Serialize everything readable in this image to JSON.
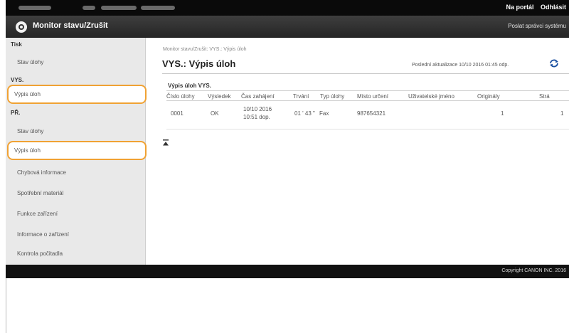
{
  "top_links": {
    "portal": "Na portál",
    "logout": "Odhlásit"
  },
  "header": {
    "title": "Monitor stavu/Zrušit",
    "mail_admin": "Poslat správci systému"
  },
  "sidebar": {
    "print_heading": "Tisk",
    "print_job_status": "Stav úlohy",
    "send_heading": "VYS.",
    "send_job_log": "Výpis úloh",
    "receive_heading": "PŘ.",
    "receive_job_status": "Stav úlohy",
    "receive_job_log": "Výpis úloh",
    "error_info": "Chybová informace",
    "consumables": "Spotřební materiál",
    "device_features": "Funkce zařízení",
    "device_info": "Informace o zařízení",
    "counter_check": "Kontrola počitadla"
  },
  "main": {
    "breadcrumb": "Monitor stavu/Zrušit: VYS.: Výpis úloh",
    "title": "VYS.: Výpis úloh",
    "last_update": "Poslední aktualizace 10/10 2016 01:45 odp.",
    "refresh_icon": "refresh-icon",
    "table_title": "Výpis úloh VYS.",
    "columns": [
      "Číslo úlohy",
      "Výsledek",
      "Čas zahájení",
      "Trvání",
      "Typ úlohy",
      "Místo určení",
      "Uživatelské jméno",
      "Originály",
      "Strá"
    ],
    "rows": [
      {
        "job_no": "0001",
        "result": "OK",
        "start_line1": "10/10 2016",
        "start_line2": "10:51 dop.",
        "duration": "01 ' 43 \"",
        "type": "Fax",
        "destination": "987654321",
        "user": "",
        "originals": "1",
        "pages": "1"
      }
    ],
    "pager_icon": "first-page-icon"
  },
  "footer": {
    "copyright": "Copyright CANON INC. 2016"
  },
  "colors": {
    "highlight": "#f0a234",
    "topbar": "#0a0a0a",
    "sidebar": "#e9e9e9"
  }
}
